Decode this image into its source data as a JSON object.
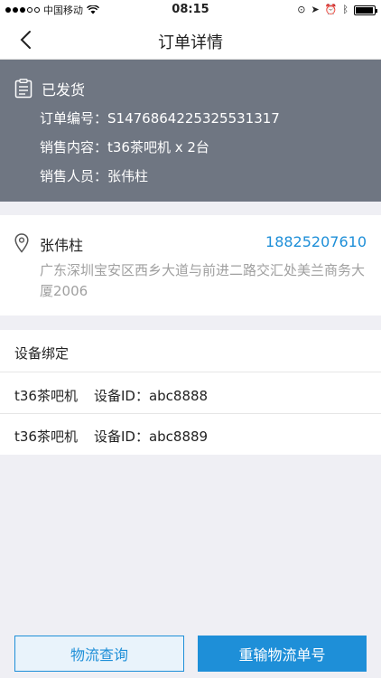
{
  "status_bar": {
    "carrier": "中国移动",
    "time": "08:15",
    "battery_level": 0.95
  },
  "nav": {
    "title": "订单详情"
  },
  "order": {
    "status": "已发货",
    "order_number": "订单编号：S1476864225325531317",
    "sales_content": "销售内容：t36茶吧机 x 2台",
    "sales_person": "销售人员：张伟柱"
  },
  "address": {
    "name": "张伟柱",
    "phone": "18825207610",
    "detail": "广东深圳宝安区西乡大道与前进二路交汇处美兰商务大厦2006"
  },
  "devices": {
    "title": "设备绑定",
    "items": [
      {
        "model": "t36茶吧机",
        "device_id": "设备ID：abc8888"
      },
      {
        "model": "t36茶吧机",
        "device_id": "设备ID：abc8889"
      }
    ]
  },
  "actions": {
    "logistics_query": "物流查询",
    "reenter_tracking": "重输物流单号"
  },
  "colors": {
    "accent": "#1e8fd8",
    "header_bg": "#6f7682"
  }
}
